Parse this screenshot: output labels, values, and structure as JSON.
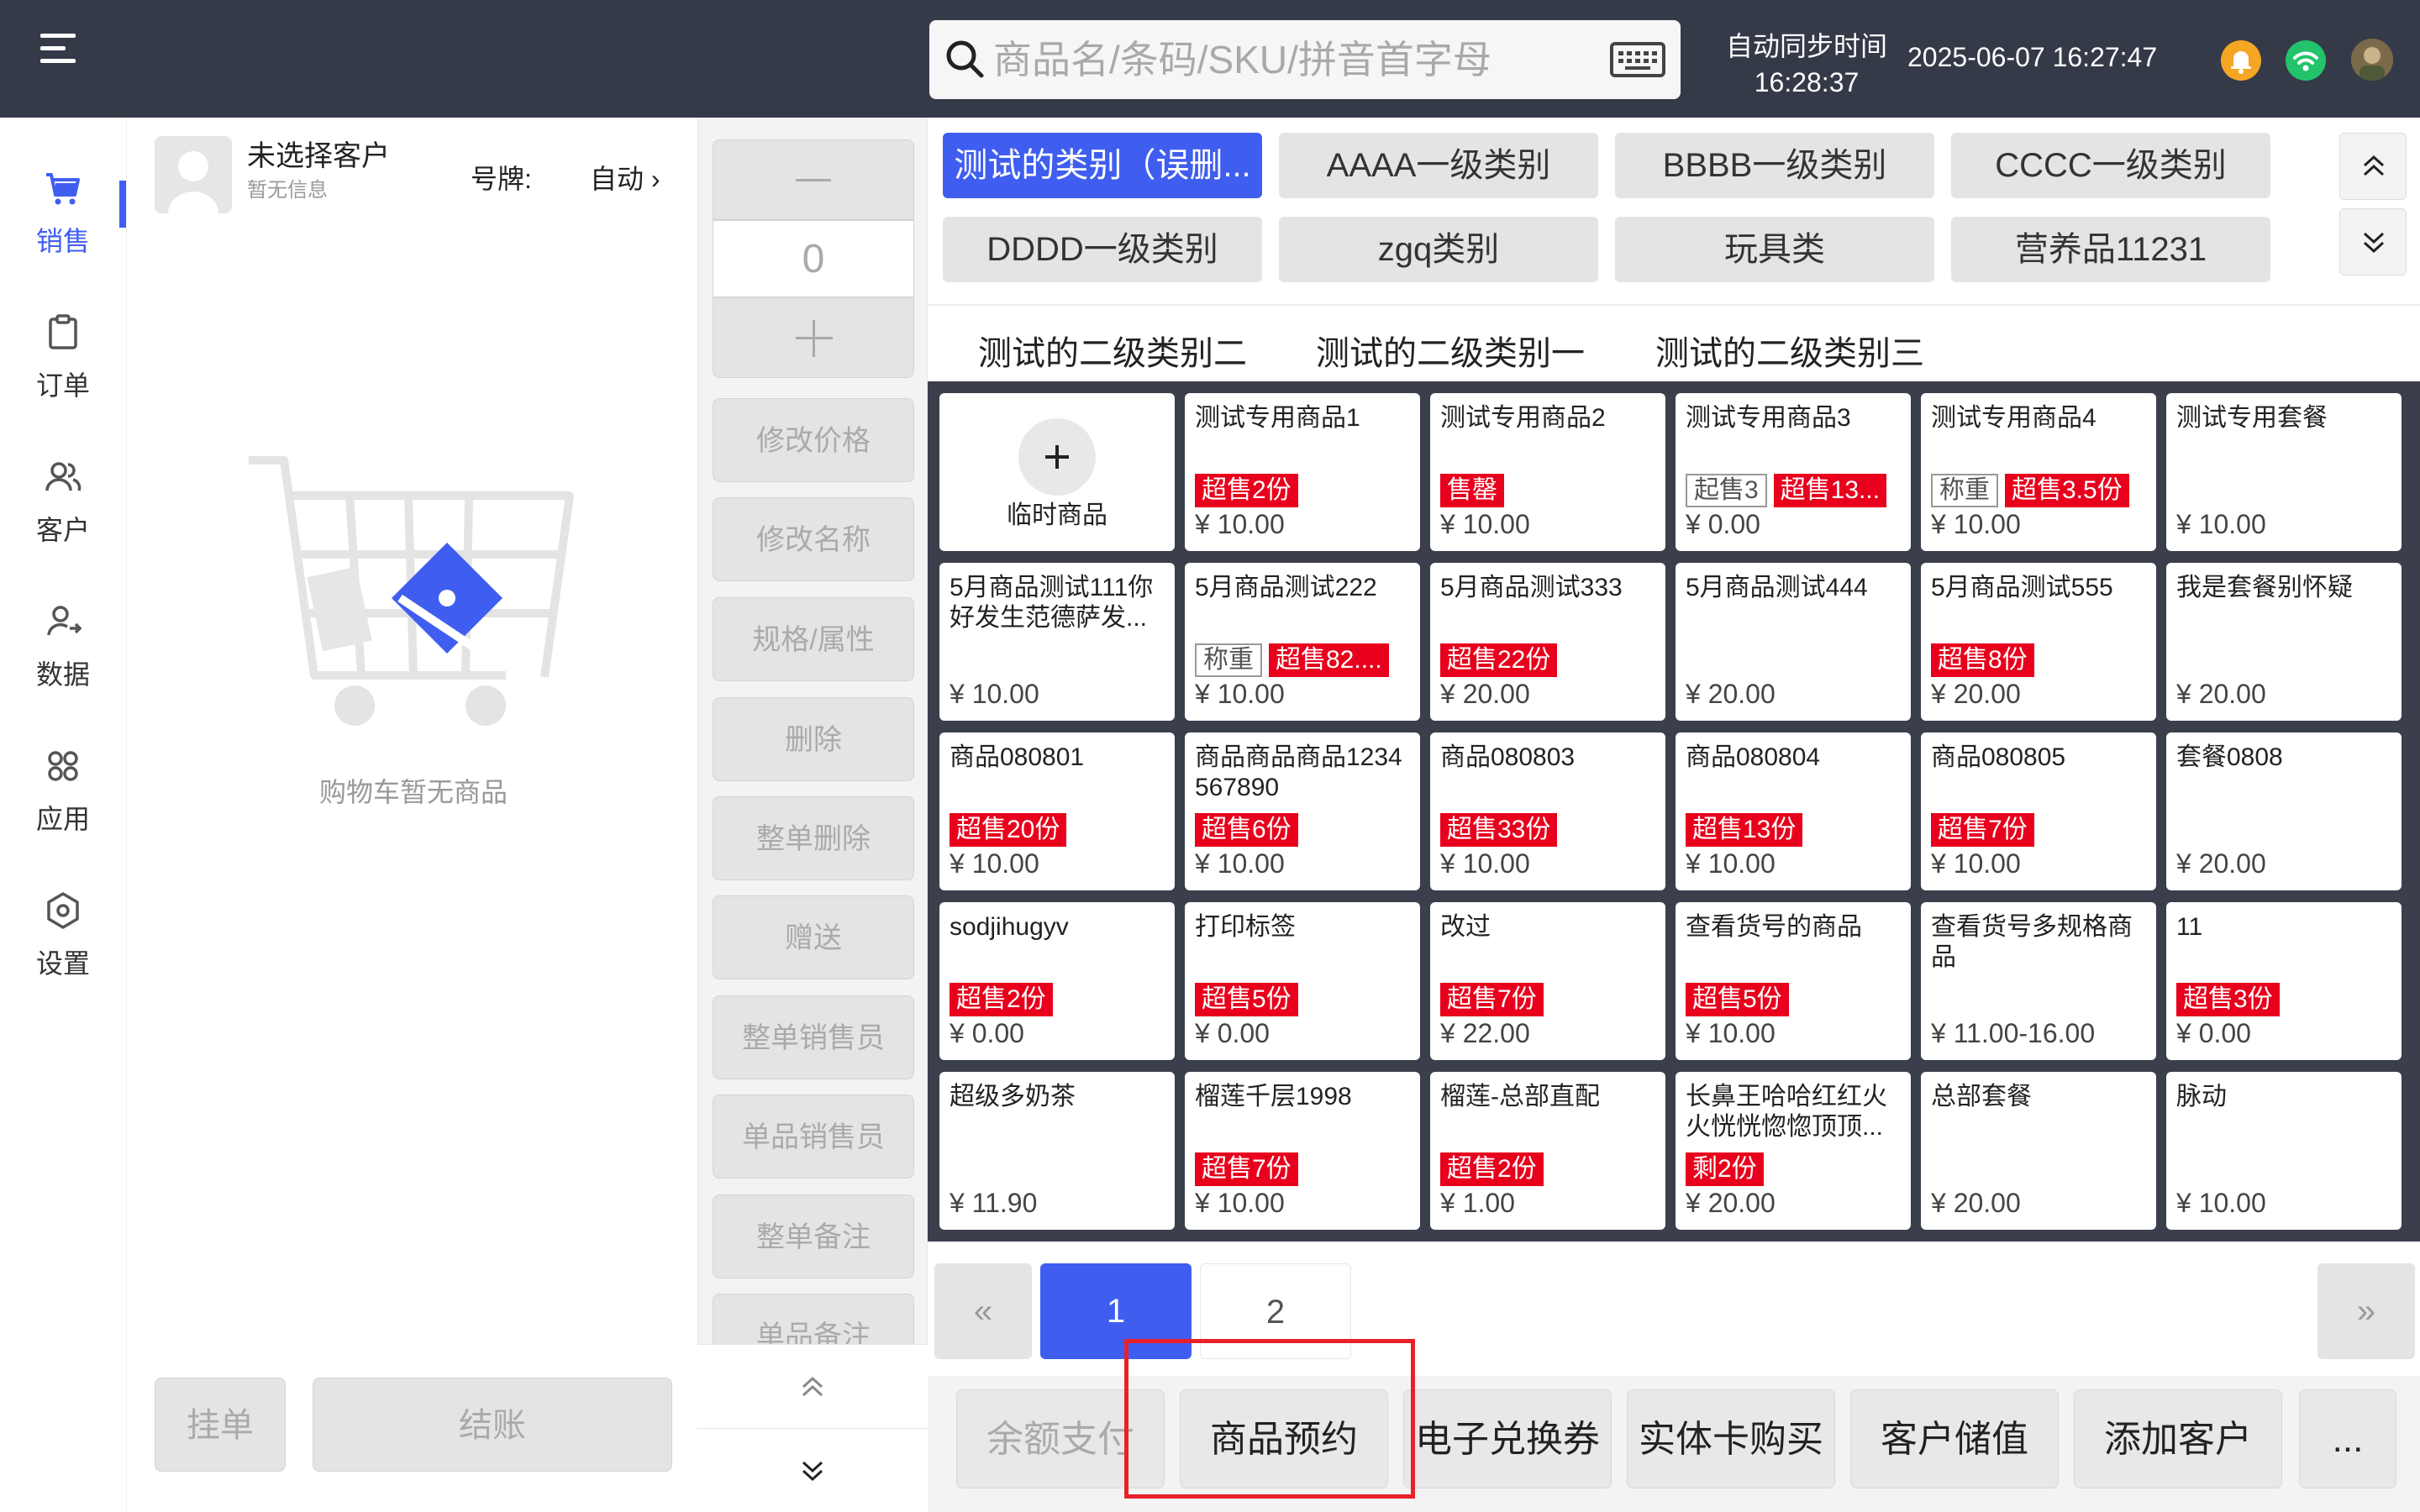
{
  "search": {
    "placeholder": "商品名/条码/SKU/拼音首字母"
  },
  "header": {
    "sync_label": "自动同步时间",
    "sync_time": "16:28:37",
    "datetime": "2025-06-07 16:27:47"
  },
  "nav": [
    {
      "label": "销售",
      "icon": "cart-icon",
      "active": true
    },
    {
      "label": "订单",
      "icon": "clipboard-icon"
    },
    {
      "label": "客户",
      "icon": "users-icon"
    },
    {
      "label": "数据",
      "icon": "user-data-icon"
    },
    {
      "label": "应用",
      "icon": "apps-icon"
    },
    {
      "label": "设置",
      "icon": "gear-icon"
    }
  ],
  "customer": {
    "name": "未选择客户",
    "info": "暂无信息",
    "plate_label": "号牌:",
    "plate_value": "自动 ›"
  },
  "cart": {
    "empty_text": "购物车暂无商品",
    "hold_label": "挂单",
    "checkout_label": "结账"
  },
  "qty": {
    "minus": "—",
    "value": "0",
    "plus": "+"
  },
  "actions": [
    "修改价格",
    "修改名称",
    "规格/属性",
    "删除",
    "整单删除",
    "赠送",
    "整单销售员",
    "单品销售员",
    "整单备注",
    "单品备注"
  ],
  "categories": [
    {
      "label": "测试的类别（误删...",
      "active": true
    },
    {
      "label": "AAAA一级类别"
    },
    {
      "label": "BBBB一级类别"
    },
    {
      "label": "CCCC一级类别"
    },
    {
      "label": "DDDD一级类别"
    },
    {
      "label": "zgq类别"
    },
    {
      "label": "玩具类"
    },
    {
      "label": "营养品11231"
    }
  ],
  "subcategories": [
    "测试的二级类别二",
    "测试的二级类别一",
    "测试的二级类别三"
  ],
  "temp_product": {
    "label": "临时商品",
    "plus": "+"
  },
  "products": [
    {
      "name": "测试专用商品1",
      "tags": [
        {
          "t": "超售2份",
          "s": "red"
        }
      ],
      "price": "¥ 10.00"
    },
    {
      "name": "测试专用商品2",
      "tags": [
        {
          "t": "售罄",
          "s": "red"
        }
      ],
      "price": "¥ 10.00"
    },
    {
      "name": "测试专用商品3",
      "tags": [
        {
          "t": "起售3",
          "s": "outline"
        },
        {
          "t": "超售13...",
          "s": "red"
        }
      ],
      "price": "¥ 0.00"
    },
    {
      "name": "测试专用商品4",
      "tags": [
        {
          "t": "称重",
          "s": "outline"
        },
        {
          "t": "超售3.5份",
          "s": "red"
        }
      ],
      "price": "¥ 10.00"
    },
    {
      "name": "测试专用套餐",
      "tags": [],
      "price": "¥ 10.00"
    },
    {
      "name": "5月商品测试111你好发生范德萨发...",
      "tags": [],
      "price": "¥ 10.00"
    },
    {
      "name": "5月商品测试222",
      "tags": [
        {
          "t": "称重",
          "s": "outline"
        },
        {
          "t": "超售82....",
          "s": "red"
        }
      ],
      "price": "¥ 10.00"
    },
    {
      "name": "5月商品测试333",
      "tags": [
        {
          "t": "超售22份",
          "s": "red"
        }
      ],
      "price": "¥ 20.00"
    },
    {
      "name": "5月商品测试444",
      "tags": [],
      "price": "¥ 20.00"
    },
    {
      "name": "5月商品测试555",
      "tags": [
        {
          "t": "超售8份",
          "s": "red"
        }
      ],
      "price": "¥ 20.00"
    },
    {
      "name": "我是套餐别怀疑",
      "tags": [],
      "price": "¥ 20.00"
    },
    {
      "name": "商品080801",
      "tags": [
        {
          "t": "超售20份",
          "s": "red"
        }
      ],
      "price": "¥ 10.00"
    },
    {
      "name": "商品商品商品1234567890",
      "tags": [
        {
          "t": "超售6份",
          "s": "red"
        }
      ],
      "price": "¥ 10.00"
    },
    {
      "name": "商品080803",
      "tags": [
        {
          "t": "超售33份",
          "s": "red"
        }
      ],
      "price": "¥ 10.00"
    },
    {
      "name": "商品080804",
      "tags": [
        {
          "t": "超售13份",
          "s": "red"
        }
      ],
      "price": "¥ 10.00"
    },
    {
      "name": "商品080805",
      "tags": [
        {
          "t": "超售7份",
          "s": "red"
        }
      ],
      "price": "¥ 10.00"
    },
    {
      "name": "套餐0808",
      "tags": [],
      "price": "¥ 20.00"
    },
    {
      "name": "sodjihugyv",
      "tags": [
        {
          "t": "超售2份",
          "s": "red"
        }
      ],
      "price": "¥ 0.00"
    },
    {
      "name": "打印标签",
      "tags": [
        {
          "t": "超售5份",
          "s": "red"
        }
      ],
      "price": "¥ 0.00"
    },
    {
      "name": "改过",
      "tags": [
        {
          "t": "超售7份",
          "s": "red"
        }
      ],
      "price": "¥ 22.00"
    },
    {
      "name": "查看货号的商品",
      "tags": [
        {
          "t": "超售5份",
          "s": "red"
        }
      ],
      "price": "¥ 10.00"
    },
    {
      "name": "查看货号多规格商品",
      "tags": [],
      "price": "¥ 11.00-16.00"
    },
    {
      "name": "11",
      "tags": [
        {
          "t": "超售3份",
          "s": "red"
        }
      ],
      "price": "¥ 0.00"
    },
    {
      "name": "超级多奶茶",
      "tags": [],
      "price": "¥ 11.90"
    },
    {
      "name": "榴莲千层1998",
      "tags": [
        {
          "t": "超售7份",
          "s": "red"
        }
      ],
      "price": "¥ 10.00"
    },
    {
      "name": "榴莲-总部直配",
      "tags": [
        {
          "t": "超售2份",
          "s": "red"
        }
      ],
      "price": "¥ 1.00"
    },
    {
      "name": "长鼻王哈哈红红火火恍恍惚惚顶顶...",
      "tags": [
        {
          "t": "剩2份",
          "s": "red"
        }
      ],
      "price": "¥ 20.00"
    },
    {
      "name": "总部套餐",
      "tags": [],
      "price": "¥ 20.00"
    },
    {
      "name": "脉动",
      "tags": [],
      "price": "¥ 10.00"
    }
  ],
  "pager": {
    "prev": "«",
    "pages": [
      "1",
      "2"
    ],
    "current": "1",
    "next": "»"
  },
  "bottom_actions": [
    {
      "label": "余额支付",
      "disabled": true
    },
    {
      "label": "商品预约"
    },
    {
      "label": "电子兑换券"
    },
    {
      "label": "实体卡购买"
    },
    {
      "label": "客户储值"
    },
    {
      "label": "添加客户"
    },
    {
      "label": "..."
    }
  ],
  "colors": {
    "topbar": "#353a48",
    "accent": "#3f5ef0",
    "sale_tag": "#e8001c",
    "highlight": "#e8202a"
  }
}
